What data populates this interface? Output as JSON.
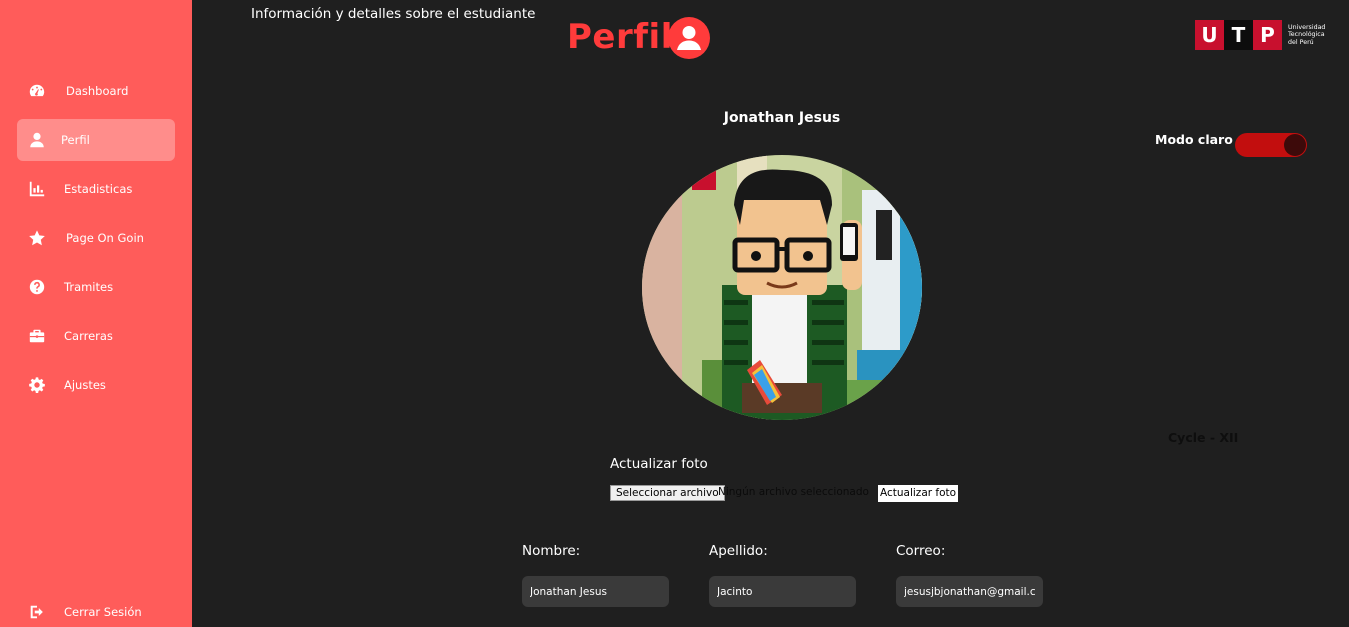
{
  "sidebar": {
    "items": [
      {
        "label": "Dashboard",
        "icon": "dashboard-icon"
      },
      {
        "label": "Perfil",
        "icon": "user-icon",
        "active": true
      },
      {
        "label": "Estadisticas",
        "icon": "bar-chart-icon"
      },
      {
        "label": "Page On Goin",
        "icon": "star-icon"
      },
      {
        "label": "Tramites",
        "icon": "question-icon"
      },
      {
        "label": "Carreras",
        "icon": "briefcase-icon"
      },
      {
        "label": "Ajustes",
        "icon": "gear-icon"
      }
    ],
    "logout_label": "Cerrar Sesión"
  },
  "header": {
    "subtitle": "Información y detalles sobre el estudiante",
    "title": "Perfil"
  },
  "logo": {
    "letters": [
      "U",
      "T",
      "P"
    ],
    "text_lines": [
      "Universidad",
      "Tecnológica",
      "del Perú"
    ]
  },
  "profile": {
    "name": "Jonathan Jesus",
    "mode_label": "Modo claro",
    "mode_on": true,
    "cycle": "Cycle - XII"
  },
  "photo": {
    "heading": "Actualizar foto",
    "file_button": "Seleccionar archivo",
    "file_status": "Ningún archivo seleccionado",
    "upload_button": "Actualizar foto"
  },
  "form": {
    "nombre_label": "Nombre:",
    "nombre_value": "Jonathan Jesus",
    "apellido_label": "Apellido:",
    "apellido_value": "Jacinto",
    "correo_label": "Correo:",
    "correo_value": "jesusjbjonathan@gmail.com"
  },
  "colors": {
    "sidebar": "#ff5c5a",
    "background": "#1f1f1f",
    "accent": "#ff3b3b",
    "toggle": "#c20e0e"
  }
}
